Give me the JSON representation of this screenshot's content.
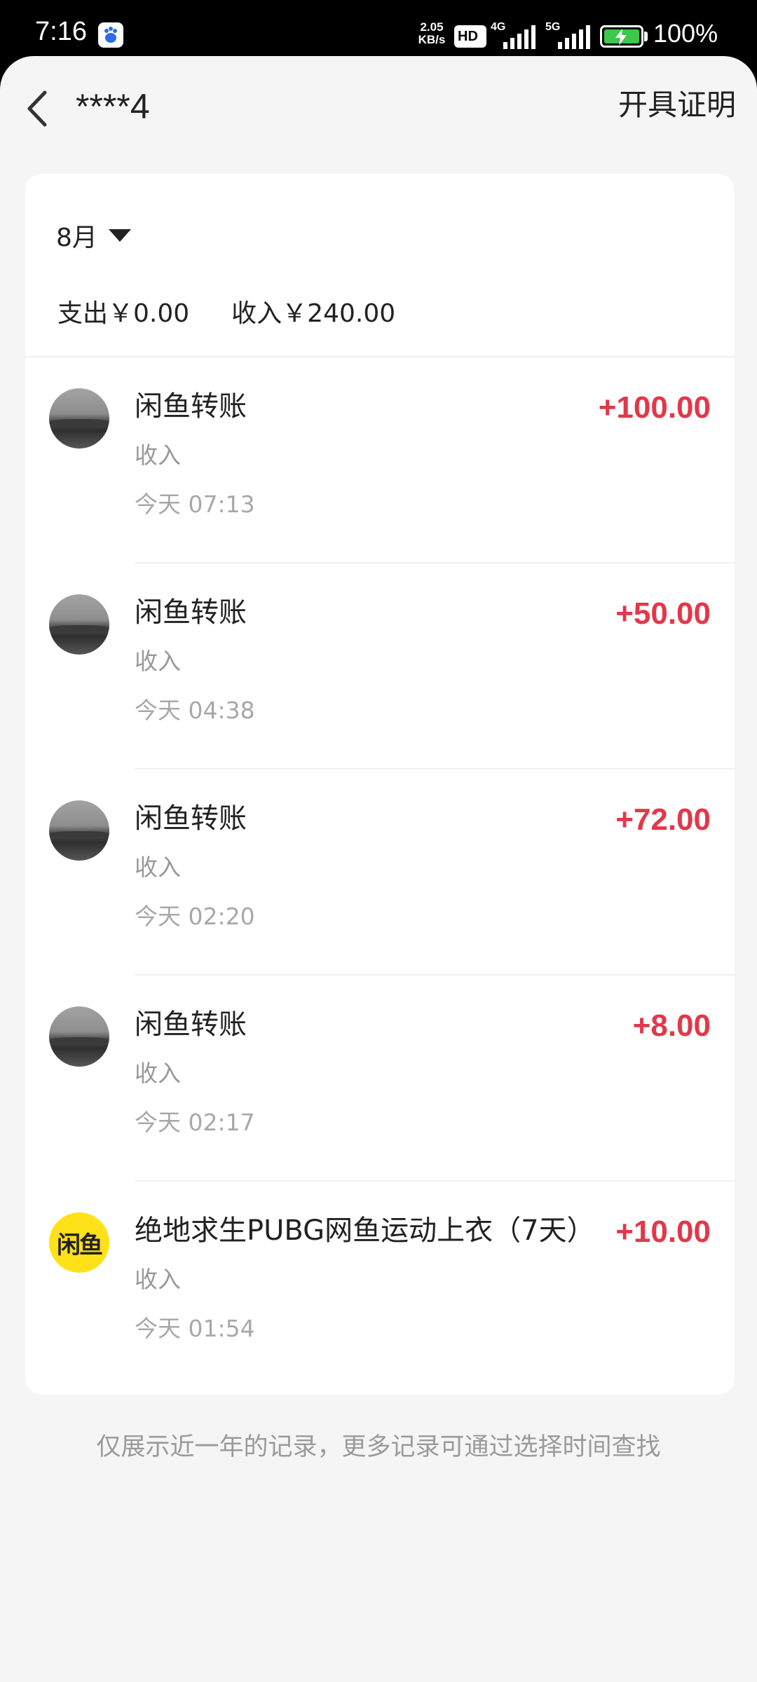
{
  "status_bar": {
    "time": "7:16",
    "net_speed_value": "2.05",
    "net_speed_unit": "KB/s",
    "hd_badge": "HD",
    "network_1": "4G",
    "network_2": "5G",
    "battery_percent": "100%",
    "battery_color": "#3cc84a"
  },
  "header": {
    "title": "****4",
    "certificate_label": "开具证明"
  },
  "filter": {
    "month_label": "8月"
  },
  "summary": {
    "expense_label": "支出￥0.00",
    "income_label": "收入￥240.00"
  },
  "transactions": [
    {
      "title": "闲鱼转账",
      "type": "收入",
      "time": "今天 07:13",
      "amount": "+100.00",
      "avatar": "photo"
    },
    {
      "title": "闲鱼转账",
      "type": "收入",
      "time": "今天 04:38",
      "amount": "+50.00",
      "avatar": "photo"
    },
    {
      "title": "闲鱼转账",
      "type": "收入",
      "time": "今天 02:20",
      "amount": "+72.00",
      "avatar": "photo"
    },
    {
      "title": "闲鱼转账",
      "type": "收入",
      "time": "今天 02:17",
      "amount": "+8.00",
      "avatar": "photo"
    },
    {
      "title": "绝地求生PUBG网鱼运动上衣（7天）",
      "type": "收入",
      "time": "今天 01:54",
      "amount": "+10.00",
      "avatar": "xianyu-logo",
      "logo_text": "闲鱼"
    }
  ],
  "footer_note": "仅展示近一年的记录，更多记录可通过选择时间查找",
  "colors": {
    "income_amount": "#e2384a",
    "page_background": "#f5f5f5",
    "xianyu_yellow": "#ffe11a"
  }
}
